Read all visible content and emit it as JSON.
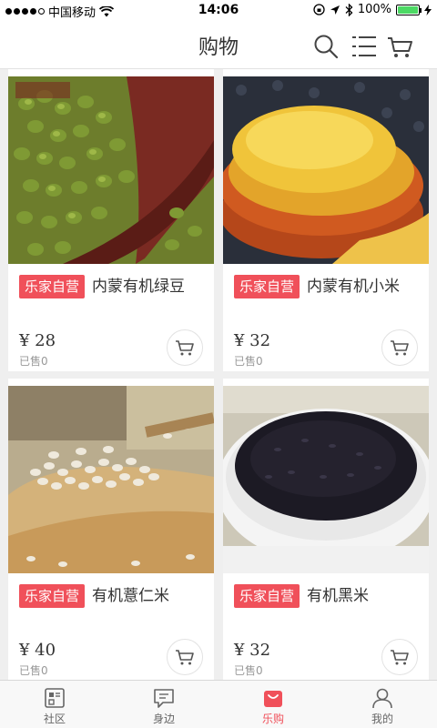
{
  "status_bar": {
    "carrier": "中国移动",
    "time": "14:06",
    "battery": "100%",
    "battery_level": 1.0
  },
  "header": {
    "title": "购物",
    "icons": [
      "search-icon",
      "list-menu-icon",
      "shopping-cart-icon"
    ]
  },
  "products": [
    {
      "tag": "乐家自营",
      "name": "内蒙有机绿豆",
      "price": "¥ 28",
      "sold": "已售0"
    },
    {
      "tag": "乐家自营",
      "name": "内蒙有机小米",
      "price": "¥ 32",
      "sold": "已售0"
    },
    {
      "tag": "乐家自营",
      "name": "有机薏仁米",
      "price": "¥ 40",
      "sold": "已售0"
    },
    {
      "tag": "乐家自营",
      "name": "有机黑米",
      "price": "¥ 32",
      "sold": "已售0"
    }
  ],
  "tabbar": {
    "tabs": [
      {
        "label": "社区",
        "icon": "community-icon"
      },
      {
        "label": "身边",
        "icon": "chat-icon"
      },
      {
        "label": "乐购",
        "icon": "shopping-bag-icon",
        "active": true
      },
      {
        "label": "我的",
        "icon": "user-icon"
      }
    ]
  },
  "colors": {
    "accent": "#f0505a",
    "background": "#efefef",
    "battery": "#4cd964"
  }
}
